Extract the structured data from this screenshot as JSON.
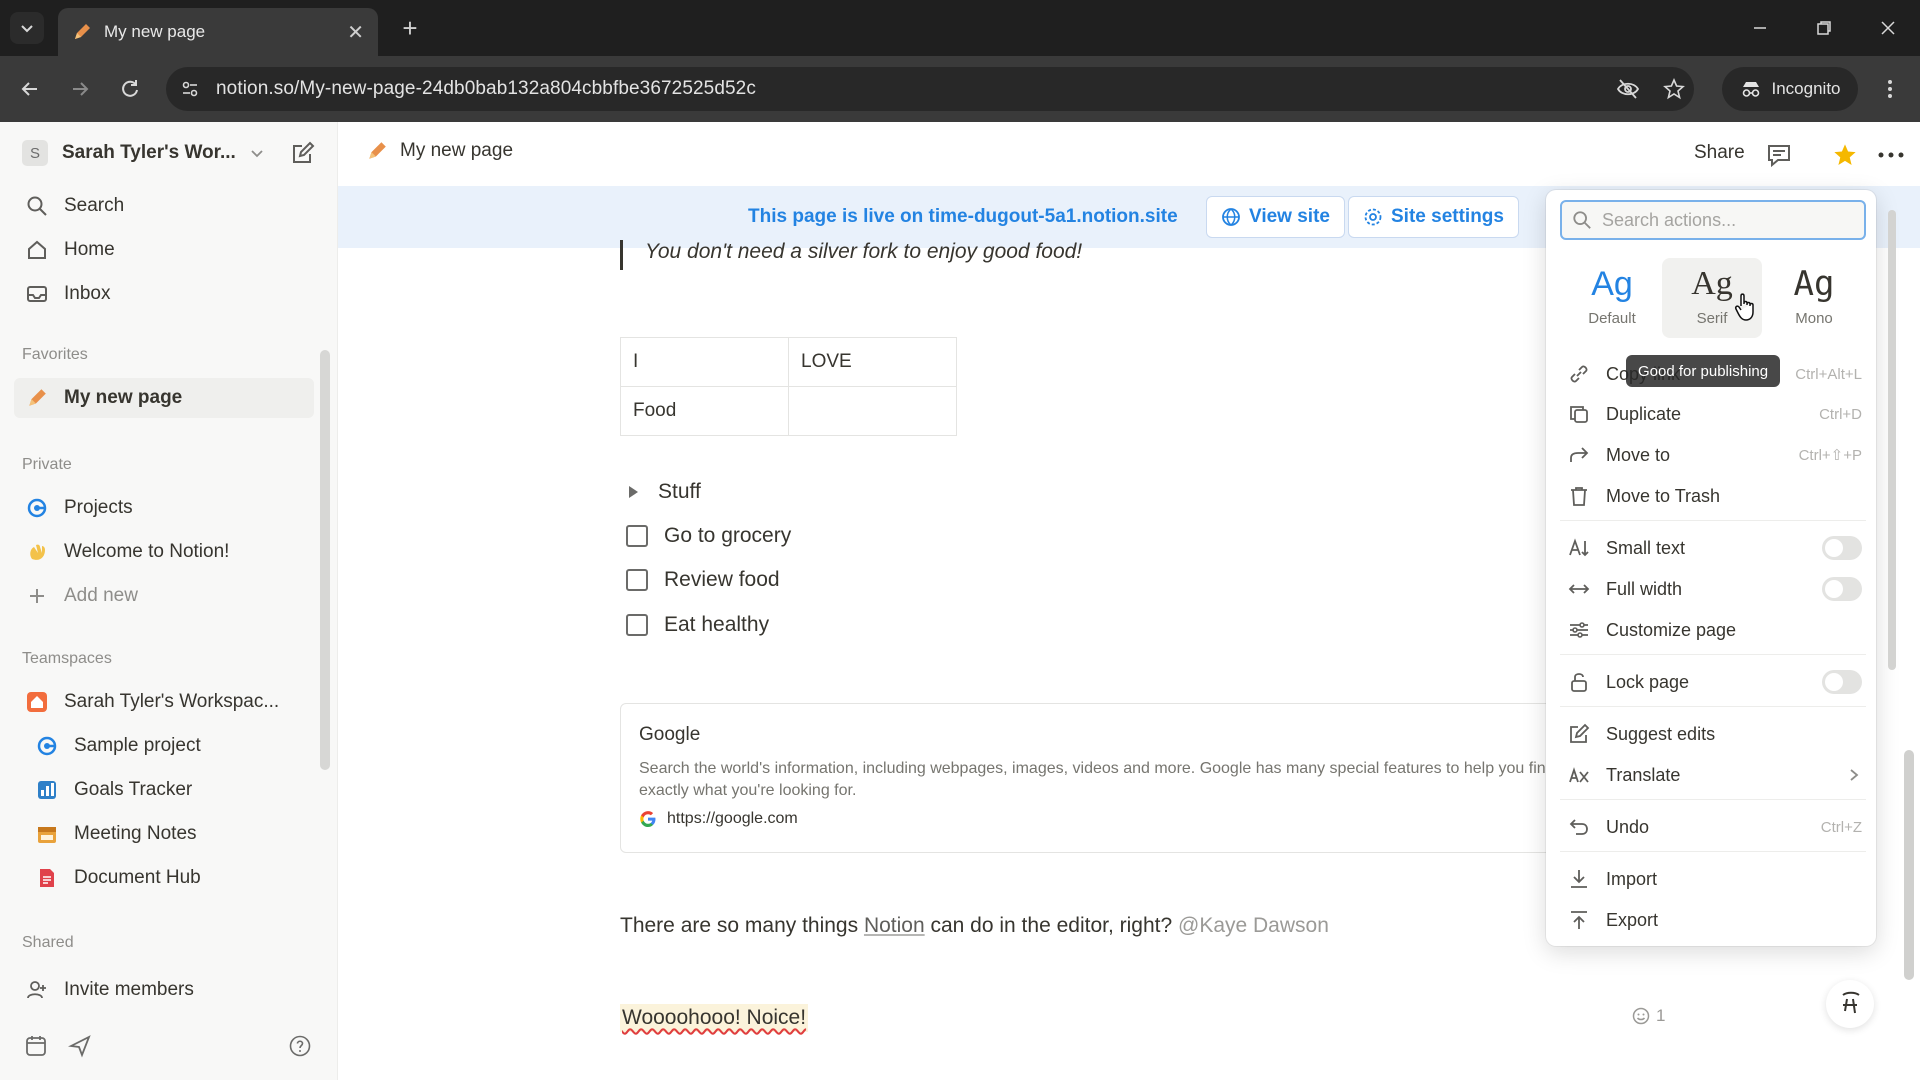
{
  "browser": {
    "tab_title": "My new page",
    "url": "notion.so/My-new-page-24db0bab132a804cbbfbe3672525d52c",
    "incognito_label": "Incognito"
  },
  "sidebar": {
    "workspace_badge": "S",
    "workspace_name": "Sarah Tyler's Wor...",
    "top_items": [
      {
        "label": "Search",
        "icon": "search-icon"
      },
      {
        "label": "Home",
        "icon": "home-icon"
      },
      {
        "label": "Inbox",
        "icon": "inbox-icon"
      }
    ],
    "favorites_label": "Favorites",
    "favorites": [
      {
        "label": "My new page",
        "icon": "pencil-icon"
      }
    ],
    "private_label": "Private",
    "private": [
      {
        "label": "Projects",
        "icon": "projects-icon"
      },
      {
        "label": "Welcome to Notion!",
        "icon": "wave-icon"
      },
      {
        "label": "Add new",
        "icon": "plus-icon"
      }
    ],
    "teamspaces_label": "Teamspaces",
    "teamspaces": [
      {
        "label": "Sarah Tyler's Workspac...",
        "icon": "house-icon"
      },
      {
        "label": "Sample project",
        "icon": "projects-icon"
      },
      {
        "label": "Goals Tracker",
        "icon": "chart-icon"
      },
      {
        "label": "Meeting Notes",
        "icon": "calendar-icon"
      },
      {
        "label": "Document Hub",
        "icon": "document-icon"
      }
    ],
    "shared_label": "Shared",
    "invite_label": "Invite members"
  },
  "topbar": {
    "page_title": "My new page",
    "share_label": "Share"
  },
  "banner": {
    "message": "This page is live on time-dugout-5a1.notion.site",
    "view_site": "View site",
    "site_settings": "Site settings"
  },
  "content": {
    "quote": "You don't need a silver fork to enjoy good food!",
    "table": [
      [
        "I",
        "LOVE"
      ],
      [
        "Food",
        ""
      ]
    ],
    "toggle": "Stuff",
    "todos": [
      "Go to grocery",
      "Review food",
      "Eat healthy"
    ],
    "bookmark": {
      "title": "Google",
      "description": "Search the world's information, including webpages, images, videos and more. Google has many special features to help you find exactly what you're looking for.",
      "url": "https://google.com"
    },
    "paragraph_start": "There are so many things ",
    "paragraph_link": "Notion",
    "paragraph_mid": " can do in the editor, right? ",
    "paragraph_mention": "@Kaye Dawson",
    "noice": "Woooohooo! Noice!",
    "reaction_count": "1"
  },
  "menu": {
    "search_placeholder": "Search actions...",
    "fonts": [
      {
        "sample": "Ag",
        "label": "Default"
      },
      {
        "sample": "Ag",
        "label": "Serif"
      },
      {
        "sample": "Ag",
        "label": "Mono"
      }
    ],
    "tooltip": "Good for publishing",
    "items": {
      "copy_link": {
        "label": "Copy link",
        "shortcut": "Ctrl+Alt+L"
      },
      "duplicate": {
        "label": "Duplicate",
        "shortcut": "Ctrl+D"
      },
      "move_to": {
        "label": "Move to",
        "shortcut": "Ctrl+⇧+P"
      },
      "move_to_trash": {
        "label": "Move to Trash"
      },
      "small_text": {
        "label": "Small text",
        "on": false
      },
      "full_width": {
        "label": "Full width",
        "on": false
      },
      "customize_page": {
        "label": "Customize page"
      },
      "lock_page": {
        "label": "Lock page",
        "on": false
      },
      "suggest_edits": {
        "label": "Suggest edits"
      },
      "translate": {
        "label": "Translate"
      },
      "undo": {
        "label": "Undo",
        "shortcut": "Ctrl+Z"
      },
      "import": {
        "label": "Import"
      },
      "export": {
        "label": "Export"
      }
    }
  },
  "colors": {
    "accent": "#2383e2",
    "star": "#f5b800"
  }
}
